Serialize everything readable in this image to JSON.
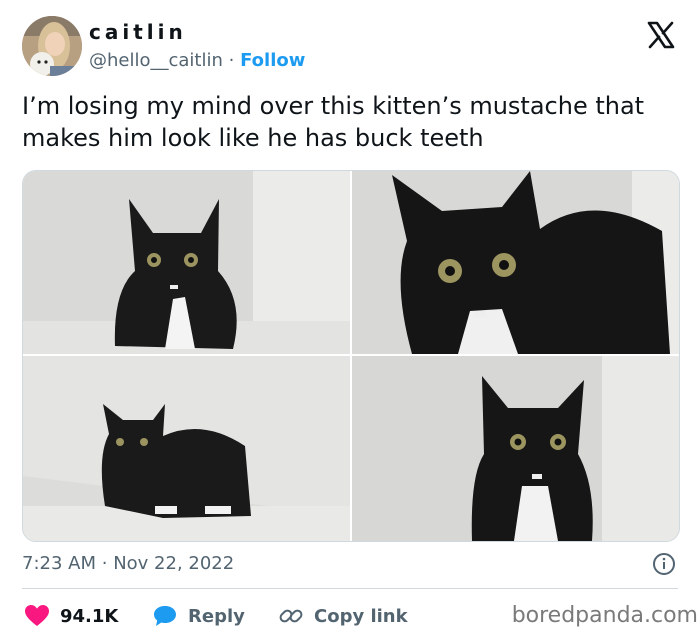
{
  "author": {
    "display_name": "caitlin",
    "handle": "@hello__caitlin",
    "separator": "·",
    "follow_label": "Follow"
  },
  "tweet": {
    "text": "I’m losing my mind over this kitten’s mustache that makes him look like he has buck teeth"
  },
  "meta": {
    "time": "7:23 AM",
    "separator": "·",
    "date": "Nov 22, 2022"
  },
  "actions": {
    "likes": "94.1K",
    "reply_label": "Reply",
    "copy_link_label": "Copy link"
  },
  "watermark": "boredpanda.com",
  "colors": {
    "accent": "#1d9bf0",
    "like": "#f91880",
    "text": "#0f1419",
    "muted": "#536471"
  },
  "icons": [
    "x-logo-icon",
    "info-icon",
    "heart-icon",
    "reply-bubble-icon",
    "link-icon"
  ]
}
